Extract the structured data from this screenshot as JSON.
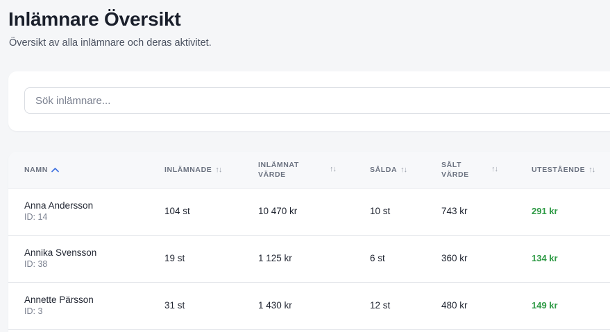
{
  "header": {
    "title": "Inlämnare Översikt",
    "subtitle": "Översikt av alla inlämnare och deras aktivitet."
  },
  "search": {
    "placeholder": "Sök inlämnare...",
    "value": ""
  },
  "table": {
    "columns": [
      {
        "key": "name",
        "label": "NAMN",
        "sort": "asc",
        "sort_icon": "chevron-up-icon"
      },
      {
        "key": "submitted",
        "label": "INLÄMNADE",
        "sort": "none",
        "sort_icon": "sort-icon"
      },
      {
        "key": "submitted_value",
        "label_1": "INLÄMNAT",
        "label_2": "VÄRDE",
        "sort": "none",
        "sort_icon": "sort-icon"
      },
      {
        "key": "sold",
        "label": "SÅLDA",
        "sort": "none",
        "sort_icon": "sort-icon"
      },
      {
        "key": "sold_value",
        "label_1": "SÅLT",
        "label_2": "VÄRDE",
        "sort": "none",
        "sort_icon": "sort-icon"
      },
      {
        "key": "outstanding",
        "label": "UTESTÅENDE",
        "sort": "none",
        "sort_icon": "sort-icon"
      }
    ],
    "rows": [
      {
        "name": "Anna Andersson",
        "id": "ID: 14",
        "submitted": "104 st",
        "submitted_value": "10 470 kr",
        "sold": "10 st",
        "sold_value": "743 kr",
        "outstanding": "291 kr"
      },
      {
        "name": "Annika Svensson",
        "id": "ID: 38",
        "submitted": "19 st",
        "submitted_value": "1 125 kr",
        "sold": "6 st",
        "sold_value": "360 kr",
        "outstanding": "134 kr"
      },
      {
        "name": "Annette Pärsson",
        "id": "ID: 3",
        "submitted": "31 st",
        "submitted_value": "1 430 kr",
        "sold": "12 st",
        "sold_value": "480 kr",
        "outstanding": "149 kr"
      }
    ]
  },
  "colors": {
    "accent": "#3b6fe0",
    "positive": "#2e9a45"
  }
}
